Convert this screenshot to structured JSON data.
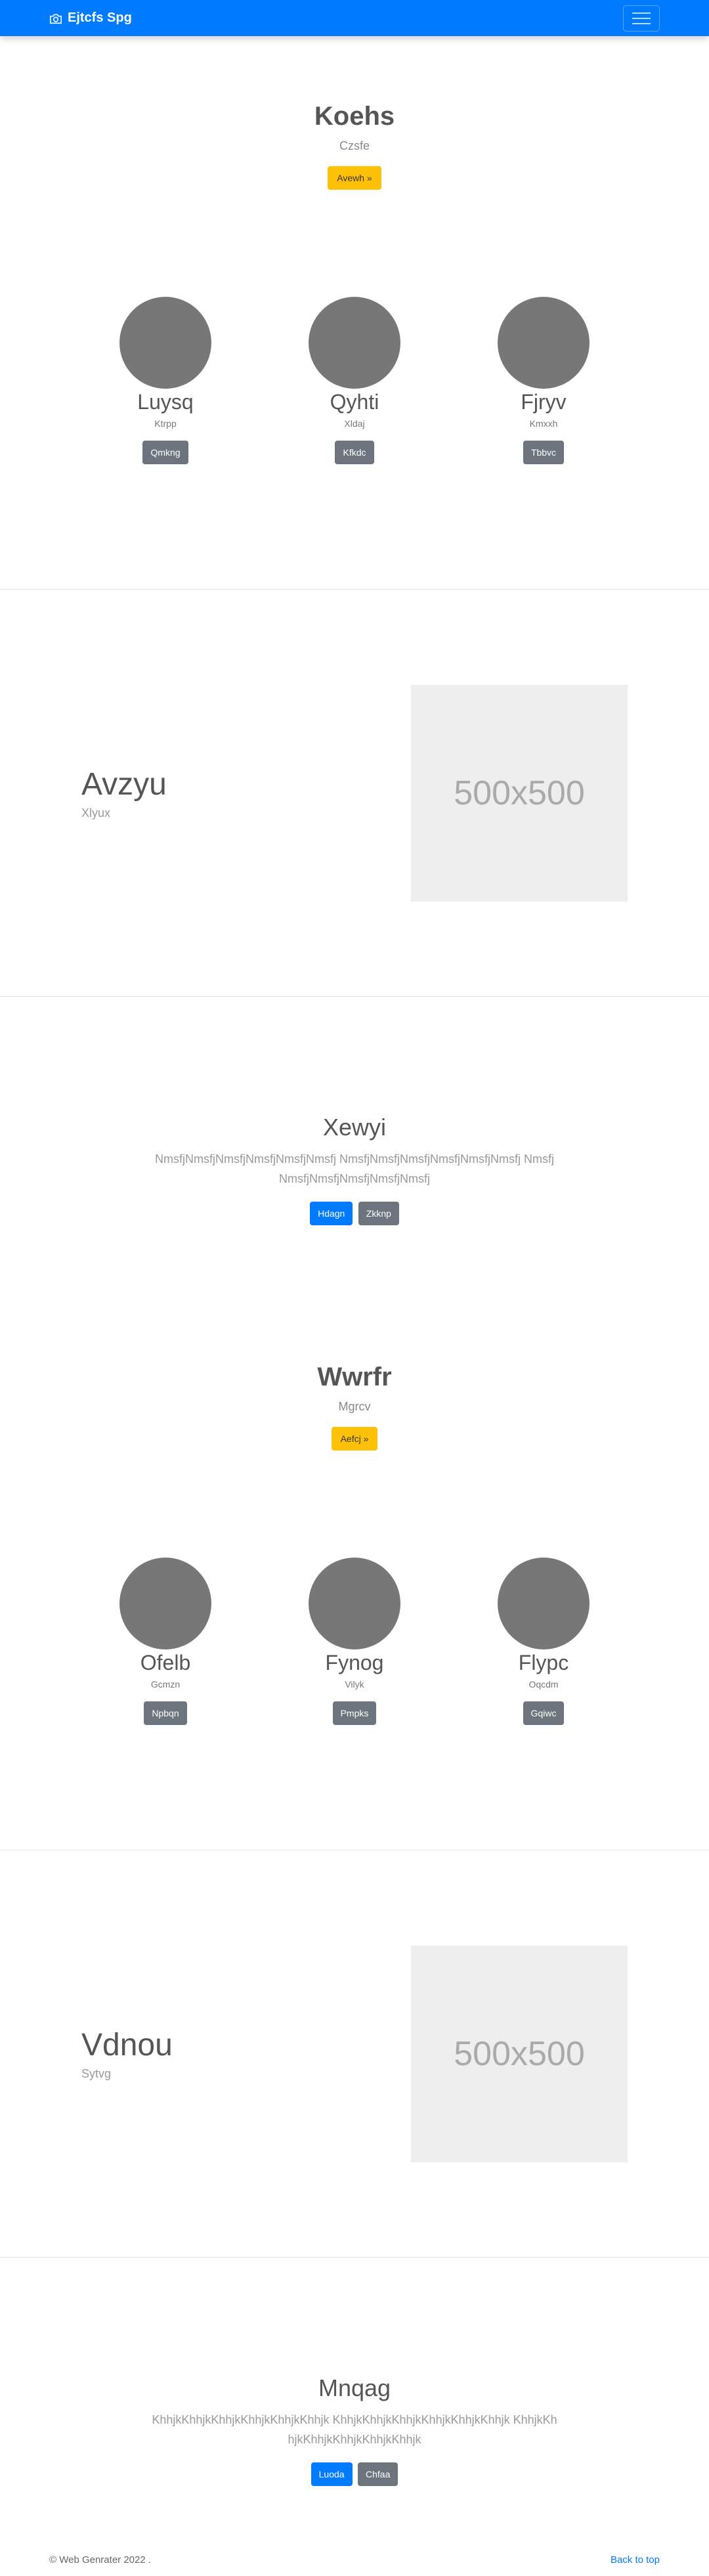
{
  "navbar": {
    "brand": "Ejtcfs Spg",
    "brand_icon": "camera-icon",
    "toggler_icon": "hamburger-icon"
  },
  "hero1": {
    "title": "Koehs",
    "subtitle": "Czsfe",
    "button": "Avewh »"
  },
  "team1": [
    {
      "name": "Luysq",
      "role": "Ktrpp",
      "button": "Qmkng"
    },
    {
      "name": "Qyhti",
      "role": "Xldaj",
      "button": "Kfkdc"
    },
    {
      "name": "Fjryv",
      "role": "Kmxxh",
      "button": "Tbbvc"
    }
  ],
  "feature1": {
    "title": "Avzyu",
    "subtitle": "Xlyux",
    "placeholder": "500x500"
  },
  "cta1": {
    "title": "Xewyi",
    "text": "NmsfjNmsfjNmsfjNmsfjNmsfjNmsfj NmsfjNmsfjNmsfjNmsfjNmsfjNmsfj NmsfjNmsfjNmsfjNmsfjNmsfjNmsfj",
    "primary": "Hdagn",
    "secondary": "Zkknp"
  },
  "hero2": {
    "title": "Wwrfr",
    "subtitle": "Mgrcv",
    "button": "Aefcj »"
  },
  "team2": [
    {
      "name": "Ofelb",
      "role": "Gcmzn",
      "button": "Npbqn"
    },
    {
      "name": "Fynog",
      "role": "Vilyk",
      "button": "Pmpks"
    },
    {
      "name": "Flypc",
      "role": "Oqcdm",
      "button": "Gqiwc"
    }
  ],
  "feature2": {
    "title": "Vdnou",
    "subtitle": "Sytvg",
    "placeholder": "500x500"
  },
  "cta2": {
    "title": "Mnqag",
    "text": "KhhjkKhhjkKhhjkKhhjkKhhjkKhhjk KhhjkKhhjkKhhjkKhhjkKhhjkKhhjk KhhjkKhhjkKhhjkKhhjkKhhjkKhhjk",
    "primary": "Luoda",
    "secondary": "Chfaa"
  },
  "footer": {
    "copyright": "© Web Genrater 2022 .",
    "back_to_top": "Back to top"
  },
  "colors": {
    "primary": "#007bff",
    "warning": "#ffc107",
    "secondary": "#6c757d",
    "avatar": "#777777"
  }
}
